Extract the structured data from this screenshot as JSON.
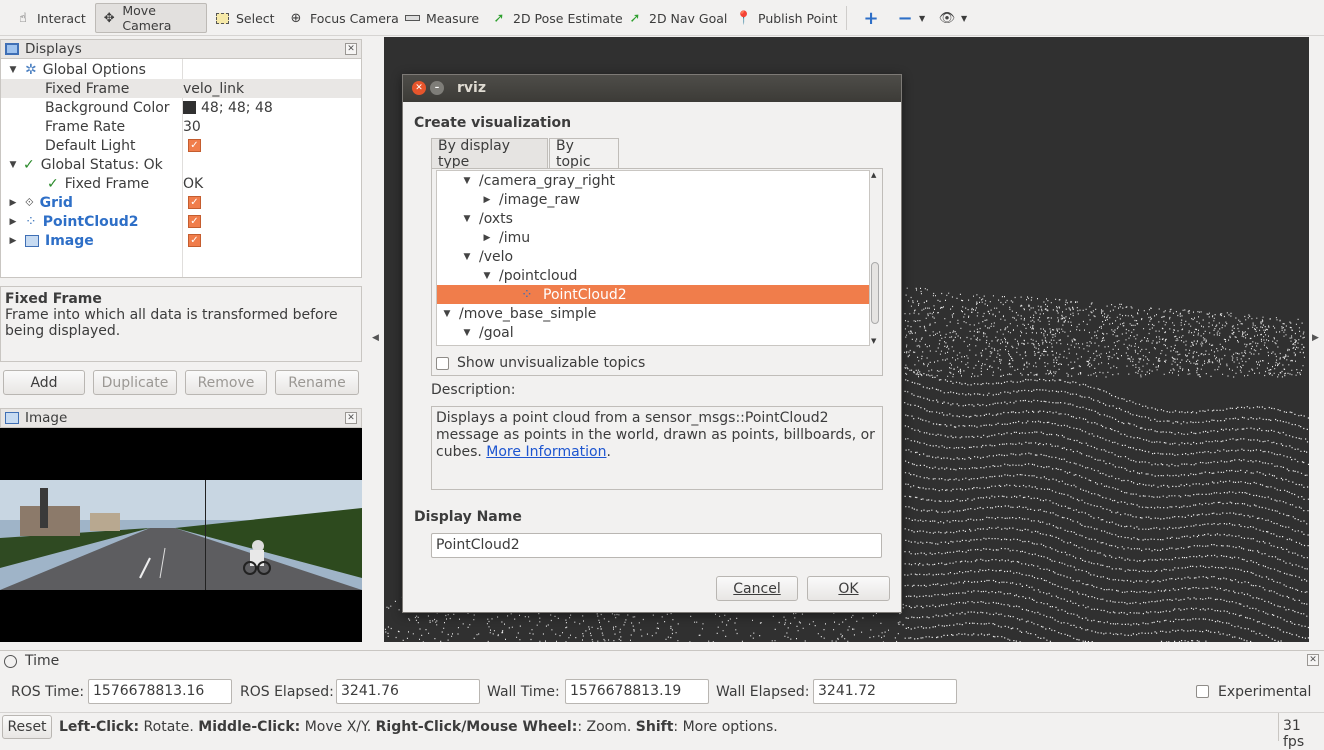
{
  "toolbar": {
    "interact": "Interact",
    "move_camera": "Move Camera",
    "select": "Select",
    "focus_camera": "Focus Camera",
    "measure": "Measure",
    "pose_estimate": "2D Pose Estimate",
    "nav_goal": "2D Nav Goal",
    "publish_point": "Publish Point"
  },
  "displays": {
    "title": "Displays",
    "rows": [
      {
        "label": "Global Options",
        "value": ""
      },
      {
        "label": "Fixed Frame",
        "value": "velo_link"
      },
      {
        "label": "Background Color",
        "value": "48; 48; 48"
      },
      {
        "label": "Frame Rate",
        "value": "30"
      },
      {
        "label": "Default Light",
        "value": ""
      },
      {
        "label": "Global Status: Ok",
        "value": ""
      },
      {
        "label": "Fixed Frame",
        "value": "OK"
      },
      {
        "label": "Grid",
        "value": ""
      },
      {
        "label": "PointCloud2",
        "value": ""
      },
      {
        "label": "Image",
        "value": ""
      }
    ],
    "desc_title": "Fixed Frame",
    "desc_text": "Frame into which all data is transformed before being displayed.",
    "buttons": {
      "add": "Add",
      "duplicate": "Duplicate",
      "remove": "Remove",
      "rename": "Rename"
    }
  },
  "image_panel": {
    "title": "Image"
  },
  "dialog": {
    "title": "rviz",
    "heading": "Create visualization",
    "tabs": [
      "By display type",
      "By topic"
    ],
    "topics": [
      {
        "label": "/camera_gray_right",
        "indent": 1,
        "arrow": "▼"
      },
      {
        "label": "/image_raw",
        "indent": 2,
        "arrow": "▶"
      },
      {
        "label": "/oxts",
        "indent": 1,
        "arrow": "▼"
      },
      {
        "label": "/imu",
        "indent": 2,
        "arrow": "▶"
      },
      {
        "label": "/velo",
        "indent": 1,
        "arrow": "▼"
      },
      {
        "label": "/pointcloud",
        "indent": 2,
        "arrow": "▼"
      },
      {
        "label": "PointCloud2",
        "indent": 4,
        "arrow": ""
      },
      {
        "label": "/move_base_simple",
        "indent": 0,
        "arrow": "▼"
      },
      {
        "label": "/goal",
        "indent": 1,
        "arrow": "▼"
      }
    ],
    "show_unvisualizable": "Show unvisualizable topics",
    "description_label": "Description:",
    "description_text": "Displays a point cloud from a sensor_msgs::PointCloud2 message as points in the world, drawn as points, billboards, or cubes.",
    "more_info": "More Information",
    "display_name_label": "Display Name",
    "display_name_value": "PointCloud2",
    "cancel": "Cancel",
    "ok": "OK"
  },
  "time": {
    "title": "Time",
    "ros_time_label": "ROS Time:",
    "ros_time": "1576678813.16",
    "ros_elapsed_label": "ROS Elapsed:",
    "ros_elapsed": "3241.76",
    "wall_time_label": "Wall Time:",
    "wall_time": "1576678813.19",
    "wall_elapsed_label": "Wall Elapsed:",
    "wall_elapsed": "3241.72",
    "experimental": "Experimental"
  },
  "status": {
    "reset": "Reset",
    "left_click": "Left-Click:",
    "left_click_desc": "Rotate.",
    "middle_click": "Middle-Click:",
    "middle_click_desc": "Move X/Y.",
    "right_click": "Right-Click/Mouse Wheel:",
    "right_click_desc": ": Zoom.",
    "shift": "Shift",
    "shift_desc": ": More options.",
    "fps": "31 fps"
  },
  "colors": {
    "accent": "#f07d4b",
    "view_bg": "#303030",
    "link": "#2e6fc7"
  }
}
